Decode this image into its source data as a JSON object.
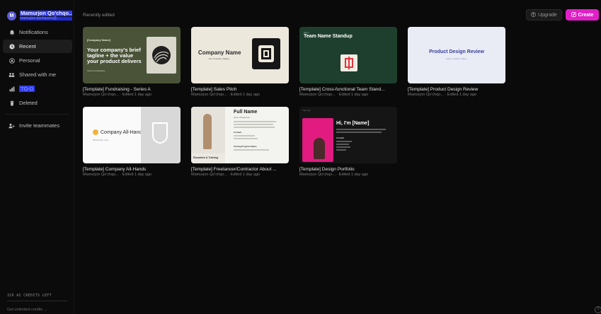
{
  "sidebar": {
    "account": {
      "initial": "M",
      "name": "Mamurjon Qo'chqo...",
      "subtitle": "mamurjon.qochqorov@..."
    },
    "items": [
      {
        "label": "Notifications",
        "icon": "bell-icon"
      },
      {
        "label": "Recent",
        "icon": "clock-icon",
        "active": true
      },
      {
        "label": "Personal",
        "icon": "user-icon"
      },
      {
        "label": "Shared with me",
        "icon": "users-icon"
      },
      {
        "label": "TO-D",
        "icon": "bar-chart-icon"
      },
      {
        "label": "Deleted",
        "icon": "trash-icon"
      }
    ],
    "invite_label": "Invite teammates",
    "credits_label": "326 AI CREDITS LEFT",
    "unlimited_label": "Get unlimited credits →"
  },
  "header": {
    "section_title": "Recently edited",
    "upgrade_label": "Upgrade",
    "create_label": "Create"
  },
  "accent_color": "#e020c6",
  "cards": [
    {
      "title": "[Template] Fundraising - Series A",
      "owner": "Mamurjon Qo'chqo...",
      "edited": "Edited 1 day ago",
      "thumb": {
        "tag": "[Company Name]",
        "heading": "Your company's brief tagline + the value your product delivers",
        "footer": "Series Fundraising"
      }
    },
    {
      "title": "[Template] Sales Pitch",
      "owner": "Mamurjon Qo'chqo...",
      "edited": "Edited 1 day ago",
      "thumb": {
        "heading": "Company Name",
        "sub": "Your Company Tagline"
      }
    },
    {
      "title": "[Template] Cross-functional Team Stand...",
      "owner": "Mamurjon Qo'chqo...",
      "edited": "Edited 1 day ago",
      "thumb": {
        "tiny": "Team",
        "heading": "Team Name Standup"
      }
    },
    {
      "title": "[Template] Product Design Review",
      "owner": "Mamurjon Qo'chqo...",
      "edited": "Edited 1 day ago",
      "thumb": {
        "heading": "Product Design Review",
        "sub": "Date, Location, Name"
      }
    },
    {
      "title": "[Template] Company All-Hands",
      "owner": "Mamurjon Qo'chqo...",
      "edited": "Edited 1 day ago",
      "thumb": {
        "heading": "Company All-Hands",
        "sub": "Month Day, Year"
      }
    },
    {
      "title": "[Template] Freelancer/Contractor About ...",
      "owner": "Mamurjon Qo'chqo...",
      "edited": "Edited 1 day ago",
      "thumb": {
        "heading": "Full Name",
        "sub": "Area of Expertise",
        "caption": "Education & Training",
        "labels": [
          "Contact",
          "Testing Program Name"
        ]
      }
    },
    {
      "title": "[Template] Design Portfolio",
      "owner": "Mamurjon Qo'chqo...",
      "edited": "Edited 1 day ago",
      "thumb": {
        "bar": "Your site",
        "heading": "Hi, I'm [Name]",
        "labels": [
          "Contact"
        ]
      }
    }
  ]
}
